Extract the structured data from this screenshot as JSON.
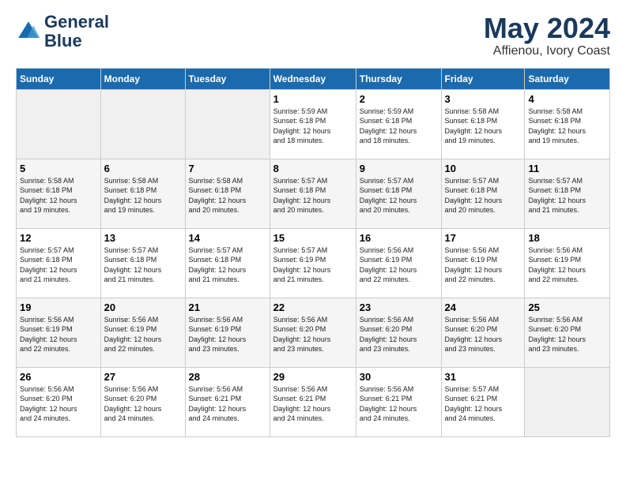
{
  "header": {
    "logo_line1": "General",
    "logo_line2": "Blue",
    "month": "May 2024",
    "location": "Affienou, Ivory Coast"
  },
  "days_of_week": [
    "Sunday",
    "Monday",
    "Tuesday",
    "Wednesday",
    "Thursday",
    "Friday",
    "Saturday"
  ],
  "weeks": [
    [
      {
        "day": "",
        "info": ""
      },
      {
        "day": "",
        "info": ""
      },
      {
        "day": "",
        "info": ""
      },
      {
        "day": "1",
        "info": "Sunrise: 5:59 AM\nSunset: 6:18 PM\nDaylight: 12 hours\nand 18 minutes."
      },
      {
        "day": "2",
        "info": "Sunrise: 5:59 AM\nSunset: 6:18 PM\nDaylight: 12 hours\nand 18 minutes."
      },
      {
        "day": "3",
        "info": "Sunrise: 5:58 AM\nSunset: 6:18 PM\nDaylight: 12 hours\nand 19 minutes."
      },
      {
        "day": "4",
        "info": "Sunrise: 5:58 AM\nSunset: 6:18 PM\nDaylight: 12 hours\nand 19 minutes."
      }
    ],
    [
      {
        "day": "5",
        "info": "Sunrise: 5:58 AM\nSunset: 6:18 PM\nDaylight: 12 hours\nand 19 minutes."
      },
      {
        "day": "6",
        "info": "Sunrise: 5:58 AM\nSunset: 6:18 PM\nDaylight: 12 hours\nand 19 minutes."
      },
      {
        "day": "7",
        "info": "Sunrise: 5:58 AM\nSunset: 6:18 PM\nDaylight: 12 hours\nand 20 minutes."
      },
      {
        "day": "8",
        "info": "Sunrise: 5:57 AM\nSunset: 6:18 PM\nDaylight: 12 hours\nand 20 minutes."
      },
      {
        "day": "9",
        "info": "Sunrise: 5:57 AM\nSunset: 6:18 PM\nDaylight: 12 hours\nand 20 minutes."
      },
      {
        "day": "10",
        "info": "Sunrise: 5:57 AM\nSunset: 6:18 PM\nDaylight: 12 hours\nand 20 minutes."
      },
      {
        "day": "11",
        "info": "Sunrise: 5:57 AM\nSunset: 6:18 PM\nDaylight: 12 hours\nand 21 minutes."
      }
    ],
    [
      {
        "day": "12",
        "info": "Sunrise: 5:57 AM\nSunset: 6:18 PM\nDaylight: 12 hours\nand 21 minutes."
      },
      {
        "day": "13",
        "info": "Sunrise: 5:57 AM\nSunset: 6:18 PM\nDaylight: 12 hours\nand 21 minutes."
      },
      {
        "day": "14",
        "info": "Sunrise: 5:57 AM\nSunset: 6:18 PM\nDaylight: 12 hours\nand 21 minutes."
      },
      {
        "day": "15",
        "info": "Sunrise: 5:57 AM\nSunset: 6:19 PM\nDaylight: 12 hours\nand 21 minutes."
      },
      {
        "day": "16",
        "info": "Sunrise: 5:56 AM\nSunset: 6:19 PM\nDaylight: 12 hours\nand 22 minutes."
      },
      {
        "day": "17",
        "info": "Sunrise: 5:56 AM\nSunset: 6:19 PM\nDaylight: 12 hours\nand 22 minutes."
      },
      {
        "day": "18",
        "info": "Sunrise: 5:56 AM\nSunset: 6:19 PM\nDaylight: 12 hours\nand 22 minutes."
      }
    ],
    [
      {
        "day": "19",
        "info": "Sunrise: 5:56 AM\nSunset: 6:19 PM\nDaylight: 12 hours\nand 22 minutes."
      },
      {
        "day": "20",
        "info": "Sunrise: 5:56 AM\nSunset: 6:19 PM\nDaylight: 12 hours\nand 22 minutes."
      },
      {
        "day": "21",
        "info": "Sunrise: 5:56 AM\nSunset: 6:19 PM\nDaylight: 12 hours\nand 23 minutes."
      },
      {
        "day": "22",
        "info": "Sunrise: 5:56 AM\nSunset: 6:20 PM\nDaylight: 12 hours\nand 23 minutes."
      },
      {
        "day": "23",
        "info": "Sunrise: 5:56 AM\nSunset: 6:20 PM\nDaylight: 12 hours\nand 23 minutes."
      },
      {
        "day": "24",
        "info": "Sunrise: 5:56 AM\nSunset: 6:20 PM\nDaylight: 12 hours\nand 23 minutes."
      },
      {
        "day": "25",
        "info": "Sunrise: 5:56 AM\nSunset: 6:20 PM\nDaylight: 12 hours\nand 23 minutes."
      }
    ],
    [
      {
        "day": "26",
        "info": "Sunrise: 5:56 AM\nSunset: 6:20 PM\nDaylight: 12 hours\nand 24 minutes."
      },
      {
        "day": "27",
        "info": "Sunrise: 5:56 AM\nSunset: 6:20 PM\nDaylight: 12 hours\nand 24 minutes."
      },
      {
        "day": "28",
        "info": "Sunrise: 5:56 AM\nSunset: 6:21 PM\nDaylight: 12 hours\nand 24 minutes."
      },
      {
        "day": "29",
        "info": "Sunrise: 5:56 AM\nSunset: 6:21 PM\nDaylight: 12 hours\nand 24 minutes."
      },
      {
        "day": "30",
        "info": "Sunrise: 5:56 AM\nSunset: 6:21 PM\nDaylight: 12 hours\nand 24 minutes."
      },
      {
        "day": "31",
        "info": "Sunrise: 5:57 AM\nSunset: 6:21 PM\nDaylight: 12 hours\nand 24 minutes."
      },
      {
        "day": "",
        "info": ""
      }
    ]
  ]
}
